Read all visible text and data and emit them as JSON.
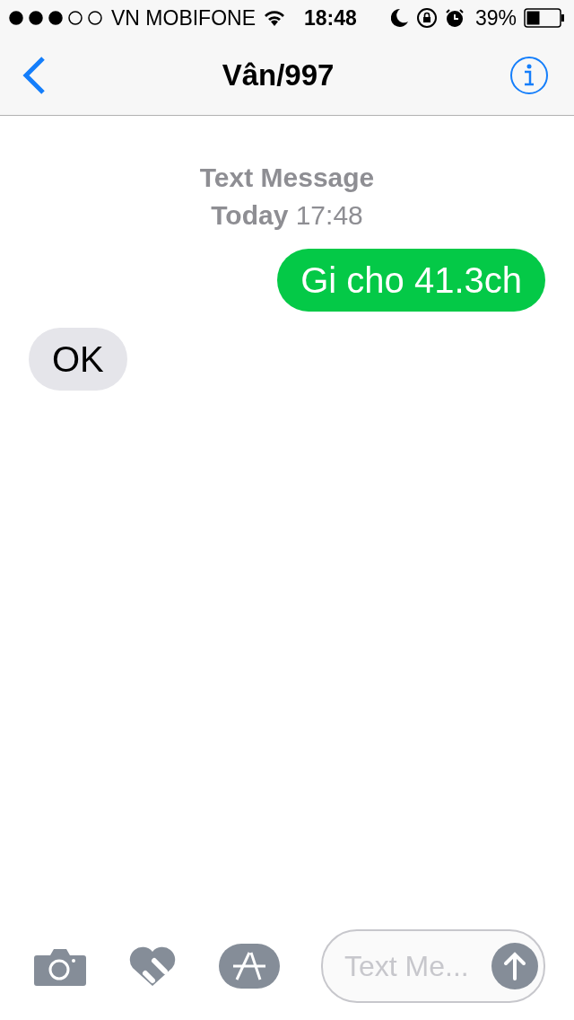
{
  "status_bar": {
    "carrier": "VN MOBIFONE",
    "time": "18:48",
    "battery": "39%"
  },
  "nav": {
    "title": "Vân/997"
  },
  "conversation": {
    "service": "Text Message",
    "timestamp": "**Today** 17:48",
    "messages": [
      {
        "kind": "sent",
        "text": "Gi cho 41.3ch"
      },
      {
        "kind": "received",
        "text": "OK"
      }
    ]
  },
  "composer": {
    "placeholder": "Text Me..."
  }
}
